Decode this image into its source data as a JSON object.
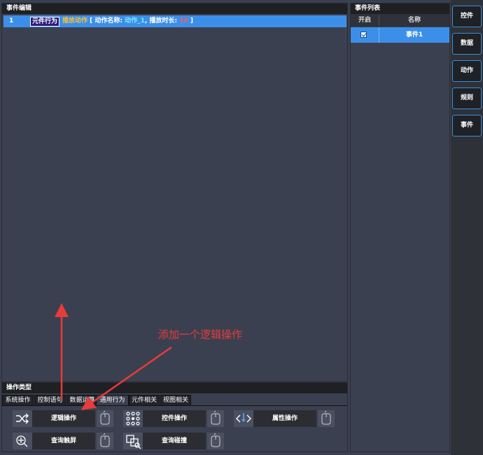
{
  "editor": {
    "title": "事件编辑",
    "row": {
      "index": "1",
      "tag": "元件行为",
      "action": "播放动作",
      "open_bracket": "[ ",
      "name_label": "动作名称: ",
      "name_value": "动作_1",
      "sep": ", ",
      "duration_label": "播放时长: ",
      "duration_value": "10",
      "close_bracket": " ]"
    }
  },
  "event_list": {
    "title": "事件列表",
    "col_enable": "开启",
    "col_name": "名称",
    "rows": [
      {
        "enabled": true,
        "name": "事件1"
      }
    ]
  },
  "right_toolbar": [
    "控件",
    "数据",
    "动作",
    "规则",
    "事件"
  ],
  "op_types": {
    "title": "操作类型",
    "tabs": [
      "系统操作",
      "控制语句",
      "数据运算",
      "通用行为",
      "元件相关",
      "视图相关"
    ],
    "active_tab": "通用行为",
    "items": [
      {
        "label": "逻辑操作",
        "icon": "shuffle-icon"
      },
      {
        "label": "控件操作",
        "icon": "grid-dots-icon"
      },
      {
        "label": "属性操作",
        "icon": "code-arrow-icon"
      },
      {
        "label": "查询触屏",
        "icon": "touch-search-icon"
      },
      {
        "label": "查询碰撞",
        "icon": "collision-search-icon"
      }
    ]
  },
  "annotation": {
    "text": "添加一个逻辑操作",
    "color": "#e83b3b"
  },
  "colors": {
    "accent": "#3c8fe8",
    "panel_bg": "#3b4050",
    "header_bg": "#1f2024"
  }
}
